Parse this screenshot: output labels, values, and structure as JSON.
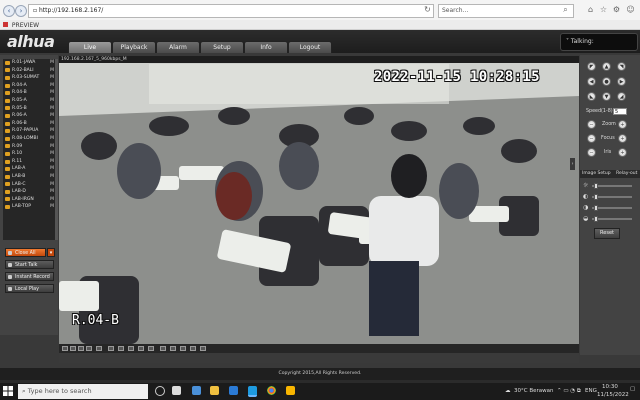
{
  "browser": {
    "address": "http://192.168.2.167/",
    "search_placeholder": "Search...",
    "tab_title": "PREVIEW"
  },
  "app": {
    "logo": "alhua",
    "tabs": [
      {
        "label": "Live",
        "active": true
      },
      {
        "label": "Playback",
        "active": false
      },
      {
        "label": "Alarm",
        "active": false
      },
      {
        "label": "Setup",
        "active": false
      },
      {
        "label": "Info",
        "active": false
      },
      {
        "label": "Logout",
        "active": false
      }
    ],
    "talking_label": "Talking:"
  },
  "channels": [
    {
      "name": "R.01-JAWA",
      "flag": "M"
    },
    {
      "name": "R.02-BALI",
      "flag": "M"
    },
    {
      "name": "R.03-SUMAT",
      "flag": "M"
    },
    {
      "name": "R.04-A",
      "flag": "M"
    },
    {
      "name": "R.04-B",
      "flag": "M"
    },
    {
      "name": "R.05-A",
      "flag": "M"
    },
    {
      "name": "R.05-B",
      "flag": "M"
    },
    {
      "name": "R.06-A",
      "flag": "M"
    },
    {
      "name": "R.06-B",
      "flag": "M"
    },
    {
      "name": "R.07-PAPUA",
      "flag": "M"
    },
    {
      "name": "R.08-LOMBI",
      "flag": "M"
    },
    {
      "name": "R.09",
      "flag": "M"
    },
    {
      "name": "R.10",
      "flag": "M"
    },
    {
      "name": "R.11",
      "flag": "M"
    },
    {
      "name": "LAB-A",
      "flag": "M"
    },
    {
      "name": "LAB-B",
      "flag": "M"
    },
    {
      "name": "LAB-C",
      "flag": "M"
    },
    {
      "name": "LAB-D",
      "flag": "M"
    },
    {
      "name": "LAB-IRGN",
      "flag": "M"
    },
    {
      "name": "LAB-TOP",
      "flag": "M"
    }
  ],
  "left_buttons": {
    "close_all": "Close All",
    "start_talk": "Start Talk",
    "instant_record": "Instant Record",
    "local_play": "Local Play"
  },
  "video": {
    "title": "192.168.2.167_5_960kbps_M",
    "timestamp": "2022-11-15  10:28:15",
    "channel_osd": "R.04-B"
  },
  "ptz": {
    "speed_label": "Speed(1-8):",
    "speed_value": "5",
    "zoom_label": "Zoom",
    "focus_label": "Focus",
    "iris_label": "Iris",
    "image_setup_label": "Image Setup",
    "relay_out_label": "Relay-out",
    "reset_label": "Reset"
  },
  "footer": "Copyright 2015,All Rights Reserved.",
  "taskbar": {
    "search_placeholder": "Type here to search",
    "weather": "30°C  Berawan",
    "language": "ENG",
    "time": "10:30",
    "date": "11/15/2022"
  }
}
